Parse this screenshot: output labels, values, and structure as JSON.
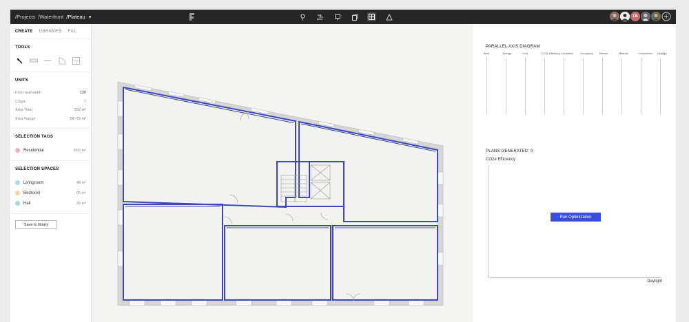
{
  "breadcrumb": {
    "projects": "/Projects",
    "waterfront": "/Waterfront",
    "current": "/Plateau"
  },
  "icons": {
    "logo": "app-logo-icon",
    "toolbar": [
      "pin-icon",
      "route-icon",
      "sign-icon",
      "duplicate-icon",
      "grid-icon",
      "triangle-icon"
    ],
    "chevron": "chevron-down-icon",
    "add_user": "plus-circle-icon"
  },
  "avatars": [
    {
      "initials": "",
      "color": "#7a7a7a"
    },
    {
      "initials": "",
      "color": "#e8e8e8"
    },
    {
      "initials": "FB",
      "color": "#c66b6b"
    },
    {
      "initials": "",
      "color": "#6e7c8a"
    },
    {
      "initials": "",
      "color": "#8a8a6e"
    }
  ],
  "left_tabs": [
    "CREATE",
    "LIBRARIES",
    "FILL"
  ],
  "tools": {
    "title": "TOOLS"
  },
  "units": {
    "title": "UNITS",
    "rows": [
      {
        "label": "Inner wall width",
        "value": "120"
      },
      {
        "label": "Count",
        "value": "7"
      },
      {
        "label": "Area Total",
        "value": "232 m²"
      },
      {
        "label": "Area Range",
        "value": "56–73 m²"
      }
    ]
  },
  "selection_tags": {
    "title": "SELECTION TAGS",
    "items": [
      {
        "label": "Residential",
        "value": "895 m²",
        "color": "#f2b3b8"
      }
    ]
  },
  "selection_spaces": {
    "title": "SELECTION SPACES",
    "items": [
      {
        "label": "Livingroom",
        "value": "48 m²",
        "color": "#a9d4ef"
      },
      {
        "label": "Bedroom",
        "value": "65 m²",
        "color": "#f6d2a4"
      },
      {
        "label": "Hall",
        "value": "36 m²",
        "color": "#9fe0c4"
      }
    ]
  },
  "save_button": "Save to library",
  "parallel_axis": {
    "title": "PARALLEL AXIS DIAGRAM",
    "axes": [
      "Area",
      "Energy",
      "Cost",
      "CO2e Efficiency",
      "Circulation",
      "Occupancy",
      "Fitness",
      "Material",
      "Connections",
      "Daylight"
    ]
  },
  "plans": {
    "title": "PLANS GENERATED: 0",
    "metric_label": "CO2e Efficiency",
    "x_label": "Daylight",
    "run_button": "Run Optimization"
  },
  "colors": {
    "wall_blue": "#3c48b4",
    "accent": "#3b4ee2",
    "topbar": "#262626"
  }
}
